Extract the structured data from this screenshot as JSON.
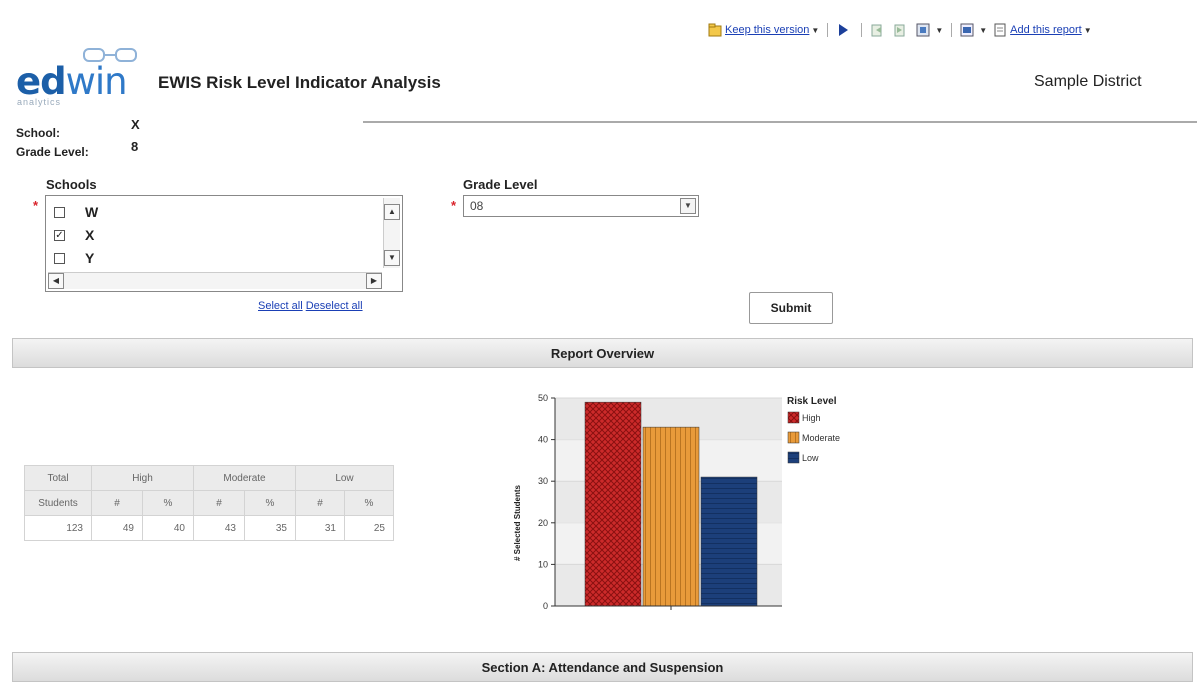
{
  "toolbar": {
    "keep_version": "Keep this version",
    "add_report": "Add this report",
    "icons": [
      "keep-version-icon",
      "play-icon",
      "back-icon",
      "forward-icon",
      "export-icon",
      "view-icon",
      "add-report-icon"
    ]
  },
  "header": {
    "logo_primary": "ed",
    "logo_secondary": "win",
    "logo_sub": "analytics",
    "title": "EWIS Risk Level Indicator Analysis",
    "district": "Sample District"
  },
  "meta": {
    "school_label": "School:",
    "school_value": "X",
    "grade_label": "Grade Level:",
    "grade_value": "8"
  },
  "filters": {
    "required_mark": "*",
    "schools_label": "Schools",
    "schools": [
      {
        "name": "W",
        "checked": false
      },
      {
        "name": "X",
        "checked": true
      },
      {
        "name": "Y",
        "checked": false
      }
    ],
    "select_all": "Select all",
    "deselect_all": "Deselect all",
    "grade_label": "Grade Level",
    "grade_value": "08",
    "submit": "Submit"
  },
  "sections": {
    "overview": "Report Overview",
    "section_a": "Section A: Attendance and Suspension"
  },
  "summary_table": {
    "header1": [
      "Total",
      "High",
      "Moderate",
      "Low"
    ],
    "header2": [
      "Students",
      "#",
      "%",
      "#",
      "%",
      "#",
      "%"
    ],
    "row": [
      "123",
      "49",
      "40",
      "43",
      "35",
      "31",
      "25"
    ]
  },
  "chart_data": {
    "type": "bar",
    "categories": [
      "High",
      "Moderate",
      "Low"
    ],
    "values": [
      49,
      43,
      31
    ],
    "colors": [
      "#cc2a2a",
      "#e08a2a",
      "#1c3f7a"
    ],
    "ylabel": "# Selected Students",
    "ylim": [
      0,
      50
    ],
    "yticks": [
      "0",
      "10",
      "20",
      "30",
      "40",
      "50"
    ],
    "legend_title": "Risk Level",
    "legend_placement": "right",
    "grid": true
  }
}
